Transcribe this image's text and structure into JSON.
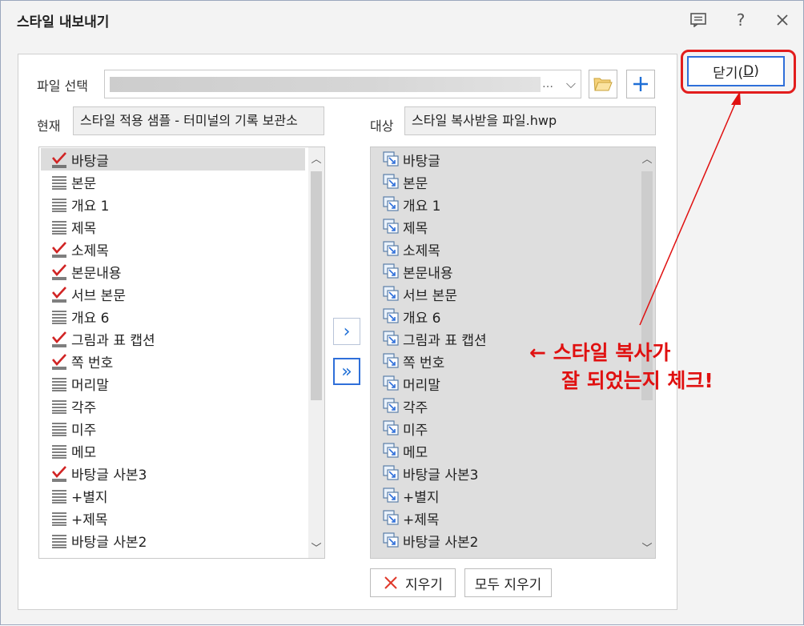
{
  "window": {
    "title": "스타일 내보내기",
    "titlebar_buttons": [
      "memo-icon",
      "help-icon",
      "close-icon"
    ]
  },
  "file_select": {
    "label": "파일 선택",
    "ellipsis": "…",
    "value_obscured": true
  },
  "current": {
    "label": "현재",
    "value": "스타일 적용 샘플 - 터미널의 기록 보관소"
  },
  "target": {
    "label": "대상",
    "value": "스타일 복사받을 파일.hwp"
  },
  "left_list": {
    "items": [
      {
        "label": "바탕글",
        "checked": true,
        "selected": true
      },
      {
        "label": "본문",
        "checked": false
      },
      {
        "label": "개요 1",
        "checked": false
      },
      {
        "label": "제목",
        "checked": false
      },
      {
        "label": "소제목",
        "checked": true
      },
      {
        "label": "본문내용",
        "checked": true
      },
      {
        "label": "서브 본문",
        "checked": true
      },
      {
        "label": "개요 6",
        "checked": false
      },
      {
        "label": "그림과 표 캡션",
        "checked": true
      },
      {
        "label": "쪽 번호",
        "checked": true
      },
      {
        "label": "머리말",
        "checked": false
      },
      {
        "label": "각주",
        "checked": false
      },
      {
        "label": "미주",
        "checked": false
      },
      {
        "label": "메모",
        "checked": false
      },
      {
        "label": "바탕글 사본3",
        "checked": true
      },
      {
        "label": "+별지",
        "checked": false
      },
      {
        "label": "+제목",
        "checked": false
      },
      {
        "label": "바탕글 사본2",
        "checked": false
      }
    ]
  },
  "right_list": {
    "items": [
      "바탕글",
      "본문",
      "개요 1",
      "제목",
      "소제목",
      "본문내용",
      "서브 본문",
      "개요 6",
      "그림과 표 캡션",
      "쪽 번호",
      "머리말",
      "각주",
      "미주",
      "메모",
      "바탕글 사본3",
      "+별지",
      "+제목",
      "바탕글 사본2"
    ]
  },
  "move_buttons": {
    "move_one": "›",
    "move_all": "»"
  },
  "bottom_buttons": {
    "delete_label": "지우기",
    "delete_all_label": "모두 지우기"
  },
  "close_button": {
    "label_main": "닫기(",
    "label_key": "D",
    "label_end": ")"
  },
  "annotation": {
    "line1": "← 스타일 복사가",
    "line2": "잘 되었는지 체크!",
    "color": "#e01010"
  },
  "colors": {
    "accent": "#2f6fd9",
    "highlight": "#e21d1d"
  }
}
